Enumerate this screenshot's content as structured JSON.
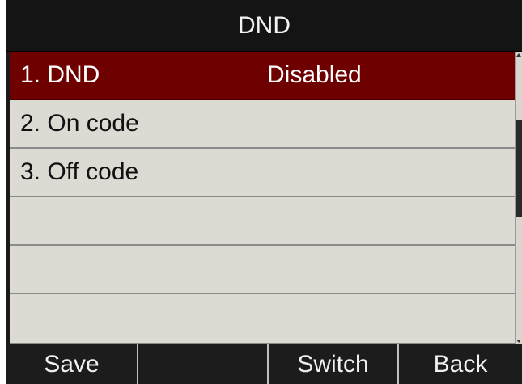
{
  "title": "DND",
  "list": {
    "items": [
      {
        "label": "1. DND",
        "value": "Disabled",
        "selected": true
      },
      {
        "label": "2. On code",
        "value": "",
        "selected": false
      },
      {
        "label": "3. Off code",
        "value": "",
        "selected": false
      },
      {
        "label": "",
        "value": "",
        "selected": false
      },
      {
        "label": "",
        "value": "",
        "selected": false
      },
      {
        "label": "",
        "value": "",
        "selected": false
      }
    ]
  },
  "scrollbar": {
    "position_fraction": 0.33
  },
  "softkeys": [
    "Save",
    "",
    "Switch",
    "Back"
  ],
  "colors": {
    "selected_row": "#6e0000",
    "row_background": "#dcdad3",
    "title_background": "#141414",
    "softkey_background": "#1a1a1a"
  }
}
